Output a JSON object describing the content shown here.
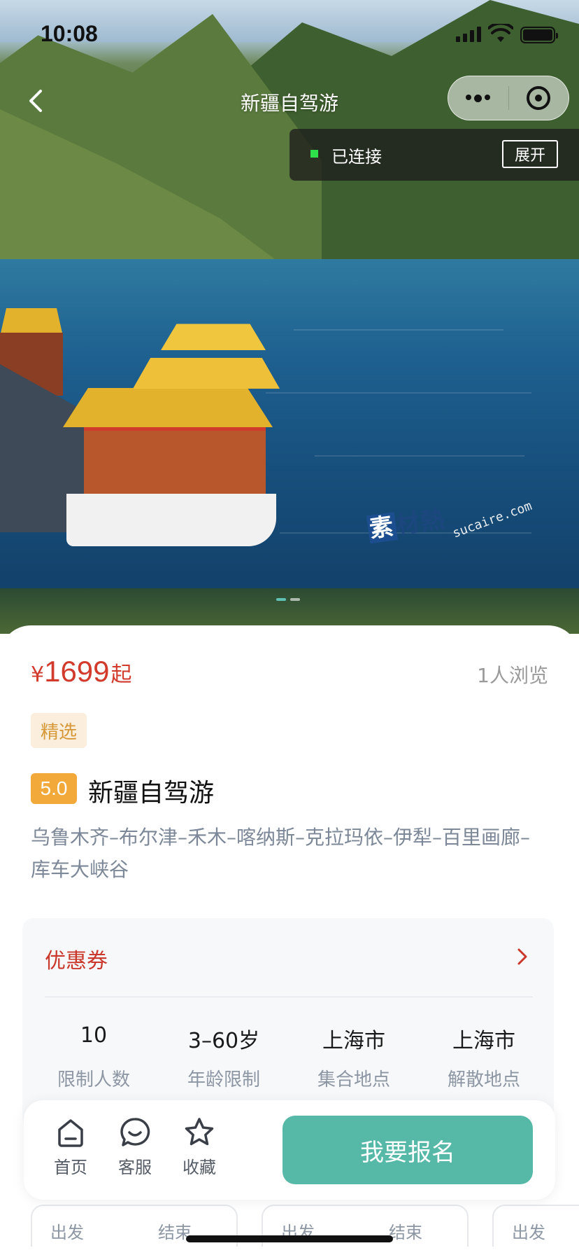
{
  "status_bar": {
    "time": "10:08"
  },
  "nav": {
    "title": "新疆自驾游"
  },
  "connection": {
    "status": "已连接",
    "expand_label": "展开"
  },
  "hero": {
    "watermark_cn": [
      "素",
      "材",
      "熱"
    ],
    "watermark_en": "sucaire.com",
    "carousel_dots": 2,
    "active_dot": 0
  },
  "product": {
    "currency": "¥",
    "price": "1699",
    "price_suffix": "起",
    "views": "1人浏览",
    "tag": "精选",
    "rating": "5.0",
    "title": "新疆自驾游",
    "route": "乌鲁木齐–布尔津–禾木–喀纳斯–克拉玛依–伊犁–百里画廊–库车大峡谷"
  },
  "coupon": {
    "label": "优惠券"
  },
  "stats": [
    {
      "value": "10",
      "label": "限制人数"
    },
    {
      "value": "3–60岁",
      "label": "年龄限制"
    },
    {
      "value": "上海市",
      "label": "集合地点"
    },
    {
      "value": "上海市",
      "label": "解散地点"
    }
  ],
  "date_chips": [
    {
      "a": "出发",
      "b": "结束"
    },
    {
      "a": "出发",
      "b": "结束"
    },
    {
      "a": "出发",
      "b": ""
    }
  ],
  "bottom_bar": {
    "tabs": [
      {
        "label": "首页",
        "icon": "home-icon"
      },
      {
        "label": "客服",
        "icon": "customer-service-icon"
      },
      {
        "label": "收藏",
        "icon": "star-icon"
      }
    ],
    "signup_label": "我要报名"
  },
  "colors": {
    "price_red": "#d23a2c",
    "accent_teal": "#56b9a7",
    "rating_orange": "#f2a93a",
    "tag_bg": "#fbeedc"
  }
}
